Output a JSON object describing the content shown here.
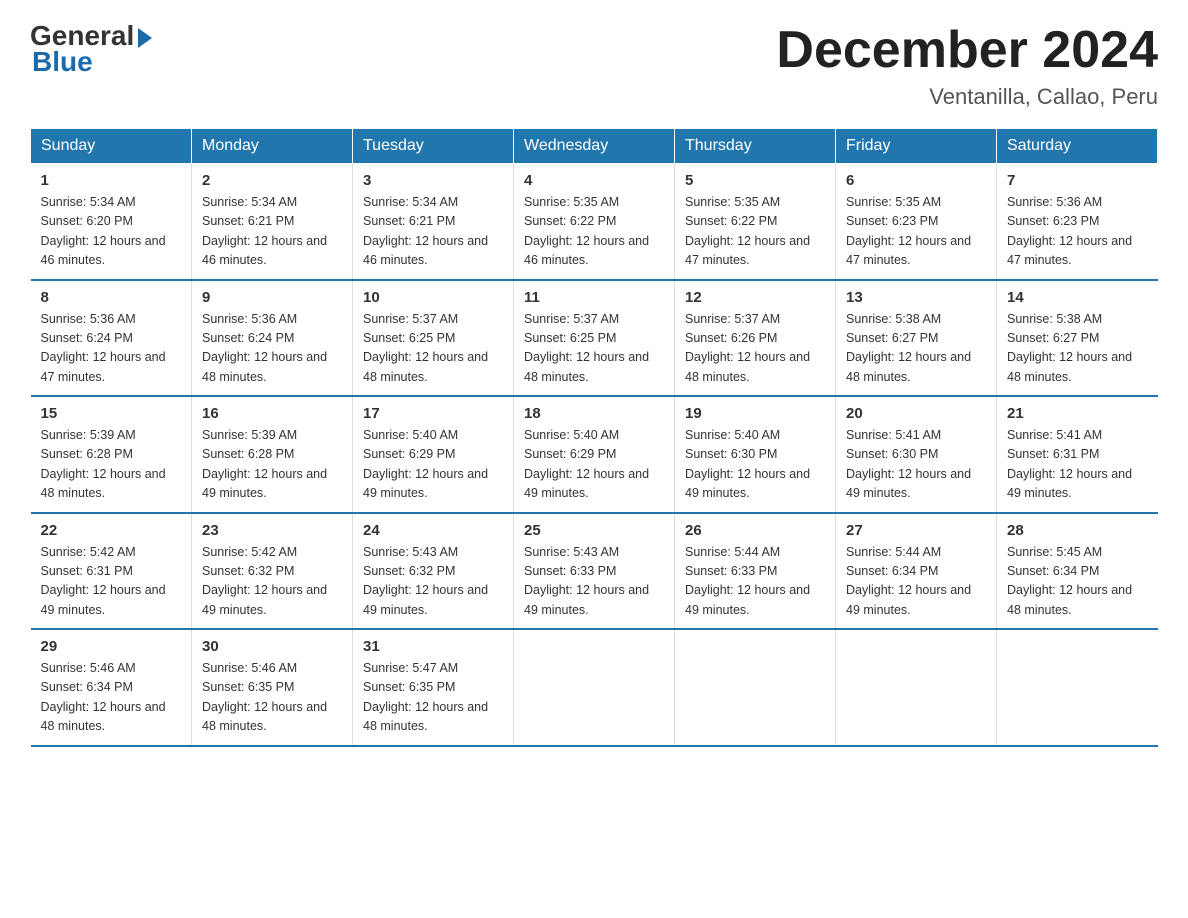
{
  "logo": {
    "general": "General",
    "blue": "Blue"
  },
  "title": "December 2024",
  "subtitle": "Ventanilla, Callao, Peru",
  "headers": [
    "Sunday",
    "Monday",
    "Tuesday",
    "Wednesday",
    "Thursday",
    "Friday",
    "Saturday"
  ],
  "weeks": [
    [
      {
        "day": "1",
        "sunrise": "5:34 AM",
        "sunset": "6:20 PM",
        "daylight": "12 hours and 46 minutes."
      },
      {
        "day": "2",
        "sunrise": "5:34 AM",
        "sunset": "6:21 PM",
        "daylight": "12 hours and 46 minutes."
      },
      {
        "day": "3",
        "sunrise": "5:34 AM",
        "sunset": "6:21 PM",
        "daylight": "12 hours and 46 minutes."
      },
      {
        "day": "4",
        "sunrise": "5:35 AM",
        "sunset": "6:22 PM",
        "daylight": "12 hours and 46 minutes."
      },
      {
        "day": "5",
        "sunrise": "5:35 AM",
        "sunset": "6:22 PM",
        "daylight": "12 hours and 47 minutes."
      },
      {
        "day": "6",
        "sunrise": "5:35 AM",
        "sunset": "6:23 PM",
        "daylight": "12 hours and 47 minutes."
      },
      {
        "day": "7",
        "sunrise": "5:36 AM",
        "sunset": "6:23 PM",
        "daylight": "12 hours and 47 minutes."
      }
    ],
    [
      {
        "day": "8",
        "sunrise": "5:36 AM",
        "sunset": "6:24 PM",
        "daylight": "12 hours and 47 minutes."
      },
      {
        "day": "9",
        "sunrise": "5:36 AM",
        "sunset": "6:24 PM",
        "daylight": "12 hours and 48 minutes."
      },
      {
        "day": "10",
        "sunrise": "5:37 AM",
        "sunset": "6:25 PM",
        "daylight": "12 hours and 48 minutes."
      },
      {
        "day": "11",
        "sunrise": "5:37 AM",
        "sunset": "6:25 PM",
        "daylight": "12 hours and 48 minutes."
      },
      {
        "day": "12",
        "sunrise": "5:37 AM",
        "sunset": "6:26 PM",
        "daylight": "12 hours and 48 minutes."
      },
      {
        "day": "13",
        "sunrise": "5:38 AM",
        "sunset": "6:27 PM",
        "daylight": "12 hours and 48 minutes."
      },
      {
        "day": "14",
        "sunrise": "5:38 AM",
        "sunset": "6:27 PM",
        "daylight": "12 hours and 48 minutes."
      }
    ],
    [
      {
        "day": "15",
        "sunrise": "5:39 AM",
        "sunset": "6:28 PM",
        "daylight": "12 hours and 48 minutes."
      },
      {
        "day": "16",
        "sunrise": "5:39 AM",
        "sunset": "6:28 PM",
        "daylight": "12 hours and 49 minutes."
      },
      {
        "day": "17",
        "sunrise": "5:40 AM",
        "sunset": "6:29 PM",
        "daylight": "12 hours and 49 minutes."
      },
      {
        "day": "18",
        "sunrise": "5:40 AM",
        "sunset": "6:29 PM",
        "daylight": "12 hours and 49 minutes."
      },
      {
        "day": "19",
        "sunrise": "5:40 AM",
        "sunset": "6:30 PM",
        "daylight": "12 hours and 49 minutes."
      },
      {
        "day": "20",
        "sunrise": "5:41 AM",
        "sunset": "6:30 PM",
        "daylight": "12 hours and 49 minutes."
      },
      {
        "day": "21",
        "sunrise": "5:41 AM",
        "sunset": "6:31 PM",
        "daylight": "12 hours and 49 minutes."
      }
    ],
    [
      {
        "day": "22",
        "sunrise": "5:42 AM",
        "sunset": "6:31 PM",
        "daylight": "12 hours and 49 minutes."
      },
      {
        "day": "23",
        "sunrise": "5:42 AM",
        "sunset": "6:32 PM",
        "daylight": "12 hours and 49 minutes."
      },
      {
        "day": "24",
        "sunrise": "5:43 AM",
        "sunset": "6:32 PM",
        "daylight": "12 hours and 49 minutes."
      },
      {
        "day": "25",
        "sunrise": "5:43 AM",
        "sunset": "6:33 PM",
        "daylight": "12 hours and 49 minutes."
      },
      {
        "day": "26",
        "sunrise": "5:44 AM",
        "sunset": "6:33 PM",
        "daylight": "12 hours and 49 minutes."
      },
      {
        "day": "27",
        "sunrise": "5:44 AM",
        "sunset": "6:34 PM",
        "daylight": "12 hours and 49 minutes."
      },
      {
        "day": "28",
        "sunrise": "5:45 AM",
        "sunset": "6:34 PM",
        "daylight": "12 hours and 48 minutes."
      }
    ],
    [
      {
        "day": "29",
        "sunrise": "5:46 AM",
        "sunset": "6:34 PM",
        "daylight": "12 hours and 48 minutes."
      },
      {
        "day": "30",
        "sunrise": "5:46 AM",
        "sunset": "6:35 PM",
        "daylight": "12 hours and 48 minutes."
      },
      {
        "day": "31",
        "sunrise": "5:47 AM",
        "sunset": "6:35 PM",
        "daylight": "12 hours and 48 minutes."
      },
      null,
      null,
      null,
      null
    ]
  ]
}
